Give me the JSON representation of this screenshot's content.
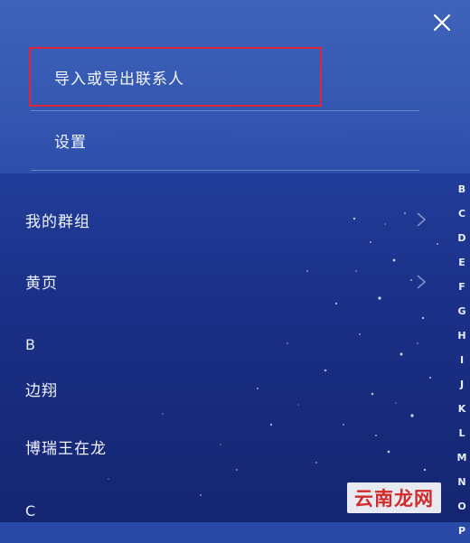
{
  "menu": {
    "items": [
      {
        "label": "导入或导出联系人"
      },
      {
        "label": "设置"
      }
    ]
  },
  "icons": {
    "close": "close-icon",
    "chevron": "chevron-right-icon"
  },
  "contacts": {
    "groups_label": "我的群组",
    "yellow_pages_label": "黄页",
    "sections": [
      {
        "letter": "B",
        "names": [
          "边翔",
          "博瑞王在龙"
        ]
      },
      {
        "letter": "C",
        "names": []
      }
    ]
  },
  "alphabet_index": [
    "B",
    "C",
    "D",
    "E",
    "F",
    "G",
    "H",
    "I",
    "J",
    "K",
    "L",
    "M",
    "N",
    "O",
    "P"
  ],
  "watermark": {
    "text": "云南龙网"
  },
  "colors": {
    "background_top": "#2a4aa8",
    "background_bottom": "#142671",
    "highlight_border": "#e0253b",
    "watermark_text": "#d12a2a"
  }
}
